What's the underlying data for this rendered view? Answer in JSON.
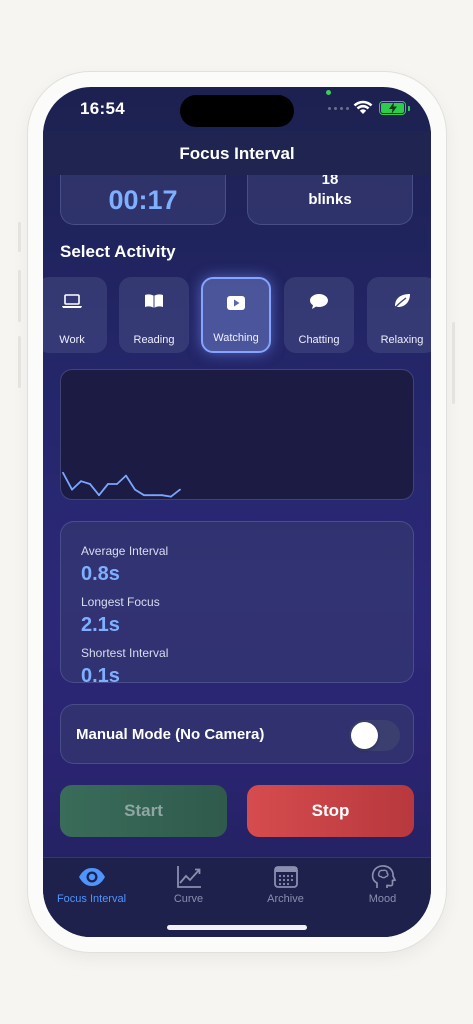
{
  "status_bar": {
    "time": "16:54"
  },
  "nav": {
    "title": "Focus Interval"
  },
  "summary": {
    "timer": "00:17",
    "blink_count": "18",
    "blink_unit": "blinks"
  },
  "activity": {
    "section_title": "Select Activity",
    "selected": "Watching",
    "items": [
      {
        "label": "Work",
        "icon": "laptop-icon"
      },
      {
        "label": "Reading",
        "icon": "book-icon"
      },
      {
        "label": "Watching",
        "icon": "play-icon"
      },
      {
        "label": "Chatting",
        "icon": "chat-bubble-icon"
      },
      {
        "label": "Relaxing",
        "icon": "leaf-icon"
      }
    ]
  },
  "chart_data": {
    "type": "line",
    "x": [
      0,
      1,
      2,
      3,
      4,
      5,
      6,
      7,
      8,
      9,
      10,
      11,
      12,
      13
    ],
    "series": [
      {
        "values": [
          0.9,
          0.3,
          0.6,
          0.5,
          0.1,
          0.5,
          0.5,
          0.8,
          0.3,
          0.1,
          0.1,
          0.1,
          0.05,
          0.3
        ]
      }
    ],
    "grid": false,
    "color": "#79a6ff"
  },
  "stats": {
    "average_label": "Average Interval",
    "average_value": "0.8s",
    "longest_label": "Longest Focus",
    "longest_value": "2.1s",
    "shortest_label": "Shortest Interval",
    "shortest_value": "0.1s"
  },
  "manual_mode": {
    "label": "Manual Mode (No Camera)",
    "enabled": false
  },
  "controls": {
    "start_label": "Start",
    "stop_label": "Stop"
  },
  "tabs": [
    {
      "label": "Focus Interval",
      "icon": "eye-icon",
      "active": true
    },
    {
      "label": "Curve",
      "icon": "chart-line-icon",
      "active": false
    },
    {
      "label": "Archive",
      "icon": "calendar-icon",
      "active": false
    },
    {
      "label": "Mood",
      "icon": "head-brain-icon",
      "active": false
    }
  ],
  "colors": {
    "accent": "#7fb0ff",
    "tab_active": "#4f95ff",
    "start_button": "#3a6c5a",
    "stop_button": "#d64c4e",
    "battery": "#2ecc4a"
  }
}
